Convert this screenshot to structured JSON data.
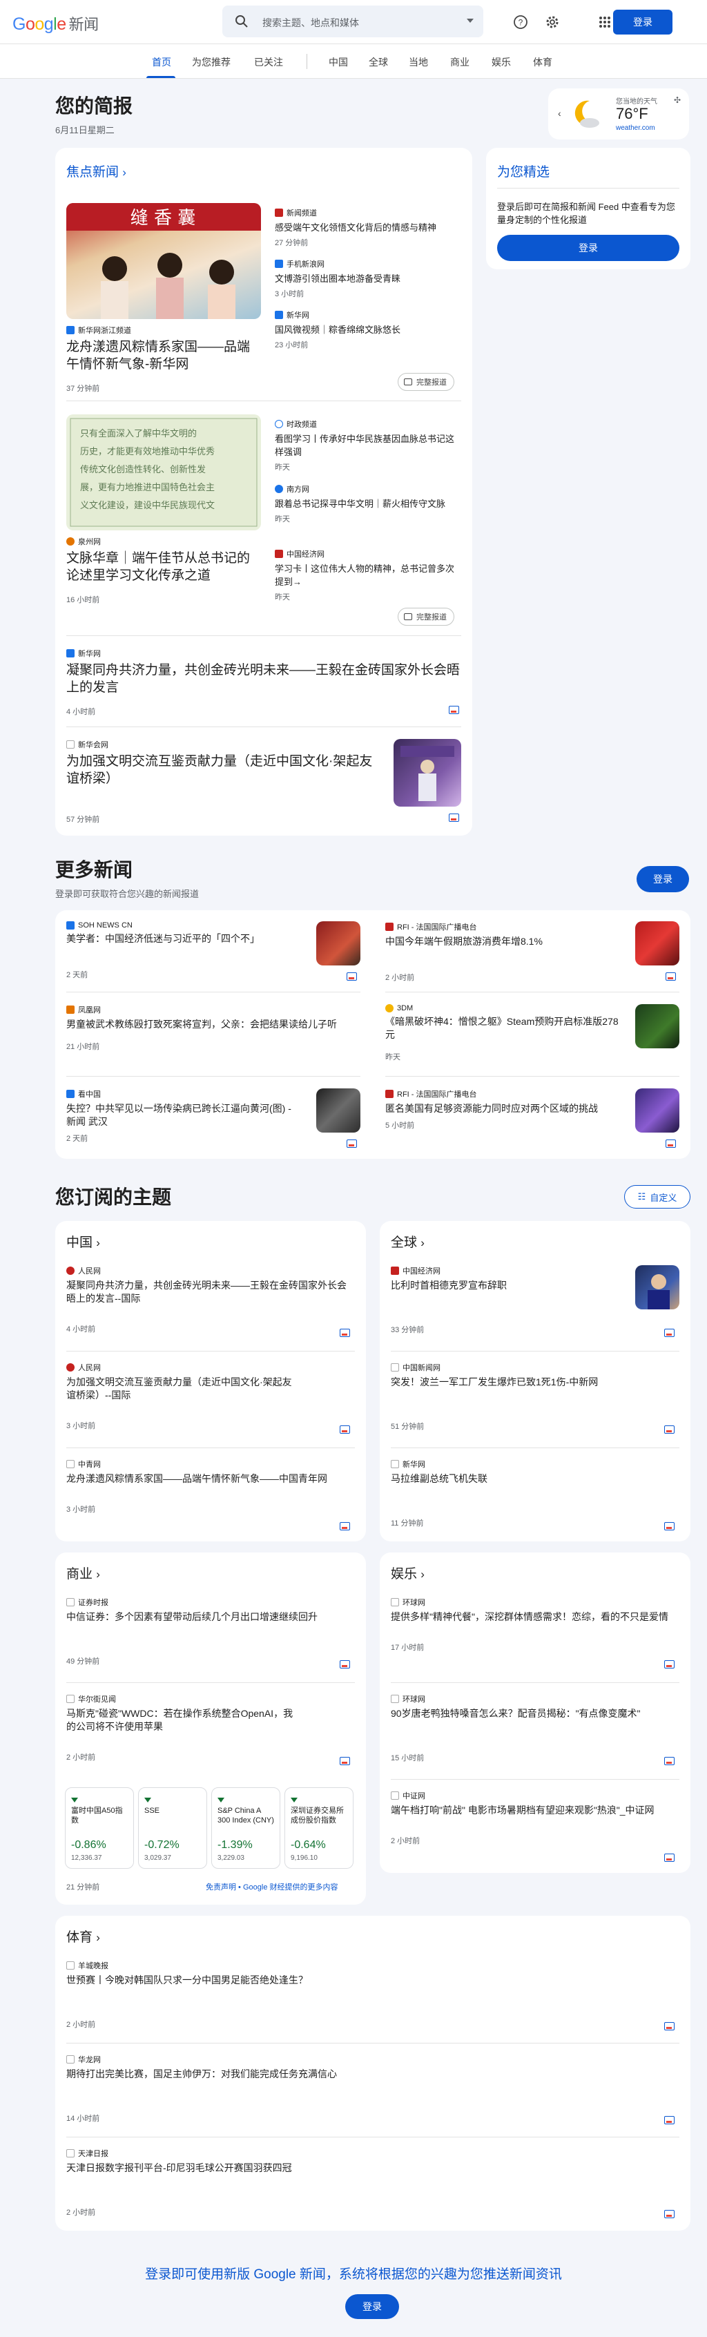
{
  "header": {
    "logo_google": "Google",
    "logo_news": "新闻",
    "search_placeholder": "搜索主题、地点和媒体",
    "signin": "登录"
  },
  "nav": [
    "首页",
    "为您推荐",
    "已关注",
    "中国",
    "全球",
    "当地",
    "商业",
    "娱乐",
    "体育"
  ],
  "briefing": {
    "title": "您的简报",
    "date": "6月11日星期二",
    "weather_label": "您当地的天气",
    "temp": "76°F",
    "weather_source": "weather.com"
  },
  "top": {
    "link": "焦点新闻",
    "stories": [
      {
        "main": {
          "source": "新华网浙江频道",
          "title": "龙舟漾遗风粽情系家国——品端午情怀新气象-新华网",
          "time": "37 分钟前"
        },
        "side": [
          {
            "source": "新闻频道",
            "title": "感受端午文化领悟文化背后的情感与精神",
            "time": "27 分钟前"
          },
          {
            "source": "手机新浪网",
            "title": "文博游引领出圈本地游备受青睐",
            "time": "3 小时前"
          },
          {
            "source": "新华网",
            "title": "国风微视频｜粽香绵绵文脉悠长",
            "time": "23 小时前"
          }
        ],
        "full": "完整报道"
      },
      {
        "main": {
          "source": "泉州网",
          "title": "文脉华章｜端午佳节从总书记的论述里学习文化传承之道",
          "time": "16 小时前"
        },
        "side": [
          {
            "source": "时政频道",
            "title": "看图学习丨传承好中华民族基因血脉总书记这样强调",
            "time": "昨天"
          },
          {
            "source": "南方网",
            "title": "跟着总书记探寻中华文明｜薪火相传守文脉",
            "time": "昨天"
          },
          {
            "source": "中国经济网",
            "title": "学习卡丨这位伟大人物的精神，总书记曾多次提到→",
            "time": "昨天"
          }
        ],
        "full": "完整报道"
      }
    ],
    "single": [
      {
        "source": "新华网",
        "title": "凝聚同舟共济力量，共创金砖光明未来——王毅在金砖国家外长会晤上的发言",
        "time": "4 小时前"
      },
      {
        "source": "新华会网",
        "title": "为加强文明交流互鉴贡献力量（走近中国文化·架起友谊桥梁）",
        "time": "57 分钟前"
      }
    ]
  },
  "picks": {
    "title": "为您精选",
    "text": "登录后即可在简报和新闻 Feed 中查看专为您量身定制的个性化报道",
    "btn": "登录"
  },
  "more": {
    "title": "更多新闻",
    "sub": "登录即可获取符合您兴趣的新闻报道",
    "btn": "登录",
    "items": [
      {
        "source": "SOH NEWS CN",
        "title": "美学者：中国经济低迷与习近平的「四个不」",
        "time": "2 天前"
      },
      {
        "source": "RFI - 法国国际广播电台",
        "title": "中国今年端午假期旅游消费年增8.1%",
        "time": "2 小时前"
      },
      {
        "source": "凤凰网",
        "title": "男童被武术教练殴打致死案将宣判，父亲：会把结果读给儿子听",
        "time": "21 小时前"
      },
      {
        "source": "3DM",
        "title": "《暗黑破坏神4：憎恨之躯》Steam预购开启标准版278元",
        "time": "昨天"
      },
      {
        "source": "看中国",
        "title": "失控？中共罕见以一场传染病已跨长江逼向黄河(图) - 新闻 武汉",
        "time": "2 天前"
      },
      {
        "source": "RFI - 法国国际广播电台",
        "title": "匿名美国有足够资源能力同时应对两个区域的挑战",
        "time": "5 小时前"
      }
    ]
  },
  "subs": {
    "title": "您订阅的主题",
    "customize": "自定义",
    "china": {
      "title": "中国",
      "items": [
        {
          "source": "人民网",
          "title": "凝聚同舟共济力量，共创金砖光明未来——王毅在金砖国家外长会晤上的发言--国际",
          "time": "4 小时前"
        },
        {
          "source": "人民网",
          "title": "为加强文明交流互鉴贡献力量（走近中国文化·架起友谊桥梁）--国际",
          "time": "3 小时前"
        },
        {
          "source": "中青网",
          "title": "龙舟漾遗风粽情系家国——品端午情怀新气象——中国青年网",
          "time": "3 小时前"
        }
      ]
    },
    "world": {
      "title": "全球",
      "items": [
        {
          "source": "中国经济网",
          "title": "比利时首相德克罗宣布辞职",
          "time": "33 分钟前"
        },
        {
          "source": "中国新闻网",
          "title": "突发！波兰一军工厂发生爆炸已致1死1伤-中新网",
          "time": "51 分钟前"
        },
        {
          "source": "新华网",
          "title": "马拉维副总统飞机失联",
          "time": "11 分钟前"
        }
      ]
    },
    "biz": {
      "title": "商业",
      "items": [
        {
          "source": "证券时报",
          "title": "中信证券：多个因素有望带动后续几个月出口增速继续回升",
          "time": "49 分钟前"
        },
        {
          "source": "华尔街见闻",
          "title": "马斯克\"碰瓷\"WWDC：若在操作系统整合OpenAI，我的公司将不许使用苹果",
          "time": "2 小时前"
        }
      ],
      "stocks": [
        {
          "name": "富时中国A50指数",
          "chg": "-0.86%",
          "val": "12,336.37"
        },
        {
          "name": "SSE",
          "chg": "-0.72%",
          "val": "3,029.37"
        },
        {
          "name": "S&P China A 300 Index (CNY)",
          "chg": "-1.39%",
          "val": "3,229.03"
        },
        {
          "name": "深圳证券交易所成份股价指数",
          "chg": "-0.64%",
          "val": "9,196.10"
        }
      ],
      "stock_time": "21 分钟前",
      "disclaimer": "免责声明 • Google 财经提供的更多内容"
    },
    "ent": {
      "title": "娱乐",
      "items": [
        {
          "source": "环球网",
          "title": "提供多样\"精神代餐\"，深挖群体情感需求！恋综，看的不只是爱情",
          "time": "17 小时前"
        },
        {
          "source": "环球网",
          "title": "90岁唐老鸭独特嗓音怎么来？配音员揭秘：\"有点像变魔术\"",
          "time": "15 小时前"
        },
        {
          "source": "中证网",
          "title": "端午档打响\"前战\" 电影市场暑期档有望迎来观影\"热浪\"_中证网",
          "time": "2 小时前"
        }
      ]
    },
    "sport": {
      "title": "体育",
      "items": [
        {
          "source": "羊城晚报",
          "title": "世预赛丨今晚对韩国队只求一分中国男足能否绝处逢生？",
          "time": "2 小时前"
        },
        {
          "source": "华龙网",
          "title": "期待打出完美比赛，国足主帅伊万：对我们能完成任务充满信心",
          "time": "14 小时前"
        },
        {
          "source": "天津日报",
          "title": "天津日报数字报刊平台-印尼羽毛球公开赛国羽获四冠",
          "time": "2 小时前"
        }
      ]
    }
  },
  "footer": {
    "text": "登录即可使用新版 Google 新闻，系统将根据您的兴趣为您推送新闻资讯",
    "btn": "登录"
  },
  "colors": {
    "accent": "#0b57d0",
    "down": "#137333"
  }
}
